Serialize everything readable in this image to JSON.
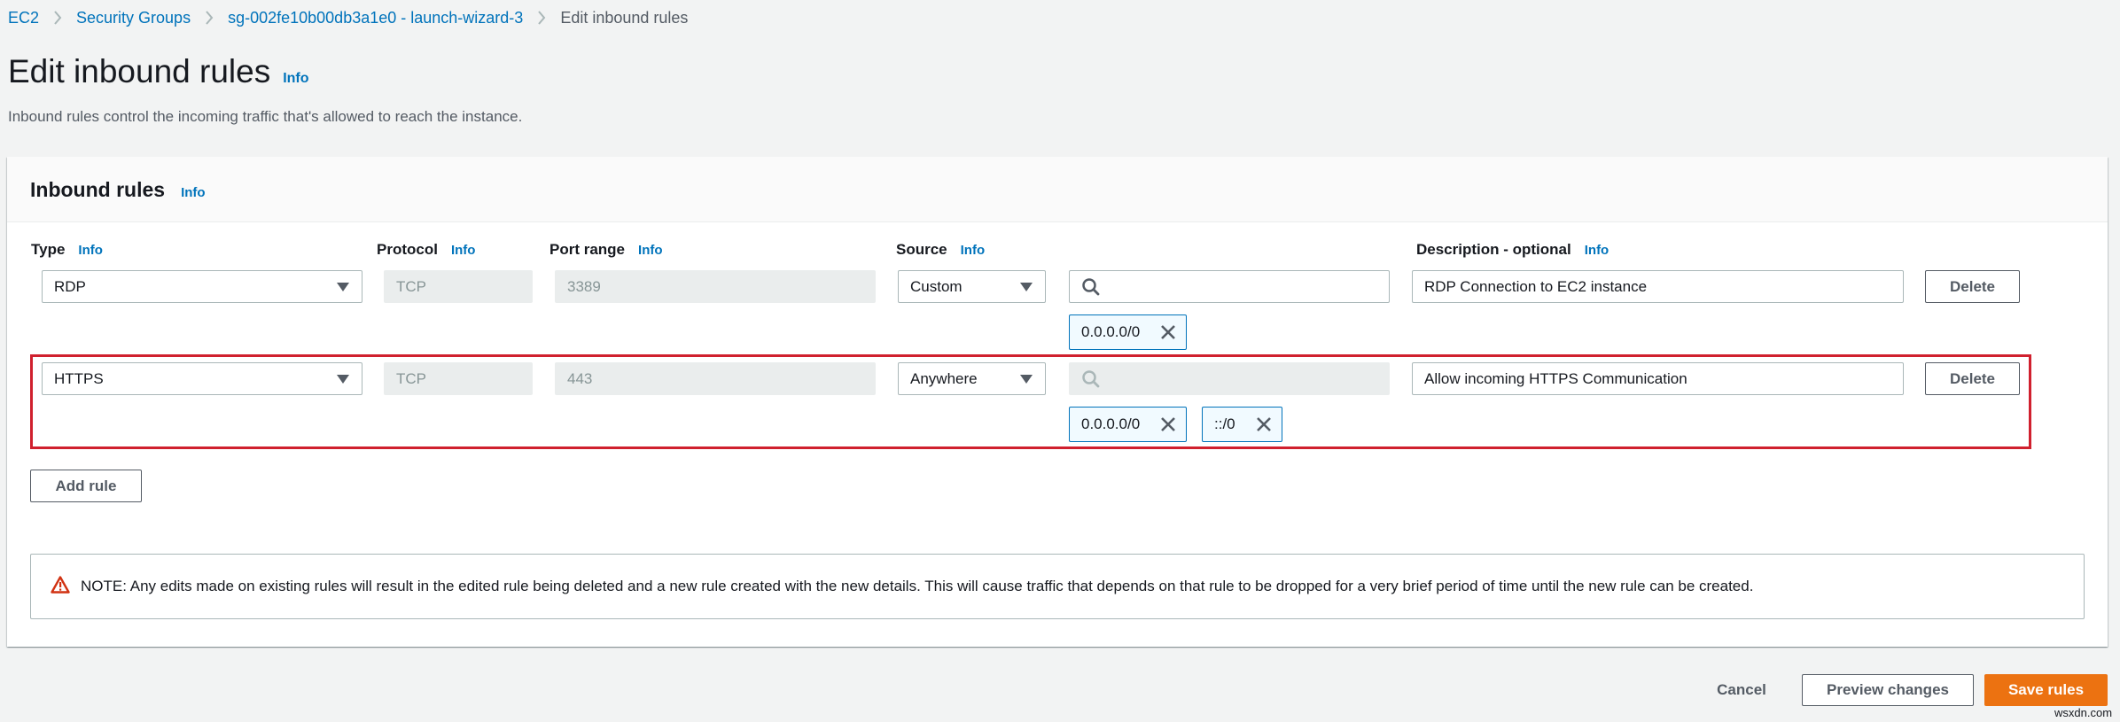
{
  "breadcrumb": {
    "items": [
      "EC2",
      "Security Groups",
      "sg-002fe10b00db3a1e0 - launch-wizard-3"
    ],
    "current": "Edit inbound rules"
  },
  "page": {
    "title": "Edit inbound rules",
    "info_label": "Info",
    "description": "Inbound rules control the incoming traffic that's allowed to reach the instance."
  },
  "panel": {
    "title": "Inbound rules",
    "info_label": "Info",
    "columns": {
      "type": "Type",
      "protocol": "Protocol",
      "port_range": "Port range",
      "source": "Source",
      "description": "Description - optional",
      "info_label": "Info"
    },
    "rules": [
      {
        "type": "RDP",
        "protocol": "TCP",
        "port_range": "3389",
        "source_mode": "Custom",
        "source_search_value": "",
        "source_search_enabled": true,
        "cidrs": [
          "0.0.0.0/0"
        ],
        "description": "RDP Connection to EC2 instance",
        "delete_label": "Delete",
        "highlighted": false
      },
      {
        "type": "HTTPS",
        "protocol": "TCP",
        "port_range": "443",
        "source_mode": "Anywhere",
        "source_search_value": "",
        "source_search_enabled": false,
        "cidrs": [
          "0.0.0.0/0",
          "::/0"
        ],
        "description": "Allow incoming HTTPS Communication",
        "delete_label": "Delete",
        "highlighted": true
      }
    ],
    "add_rule_label": "Add rule",
    "note": "NOTE: Any edits made on existing rules will result in the edited rule being deleted and a new rule created with the new details. This will cause traffic that depends on that rule to be dropped for a very brief period of time until the new rule can be created."
  },
  "footer": {
    "cancel_label": "Cancel",
    "preview_label": "Preview changes",
    "save_label": "Save rules"
  },
  "colors": {
    "link": "#0073bb",
    "primary": "#ec7211",
    "highlight": "#d0202e",
    "warning": "#d13212"
  },
  "watermark": "wsxdn.com"
}
